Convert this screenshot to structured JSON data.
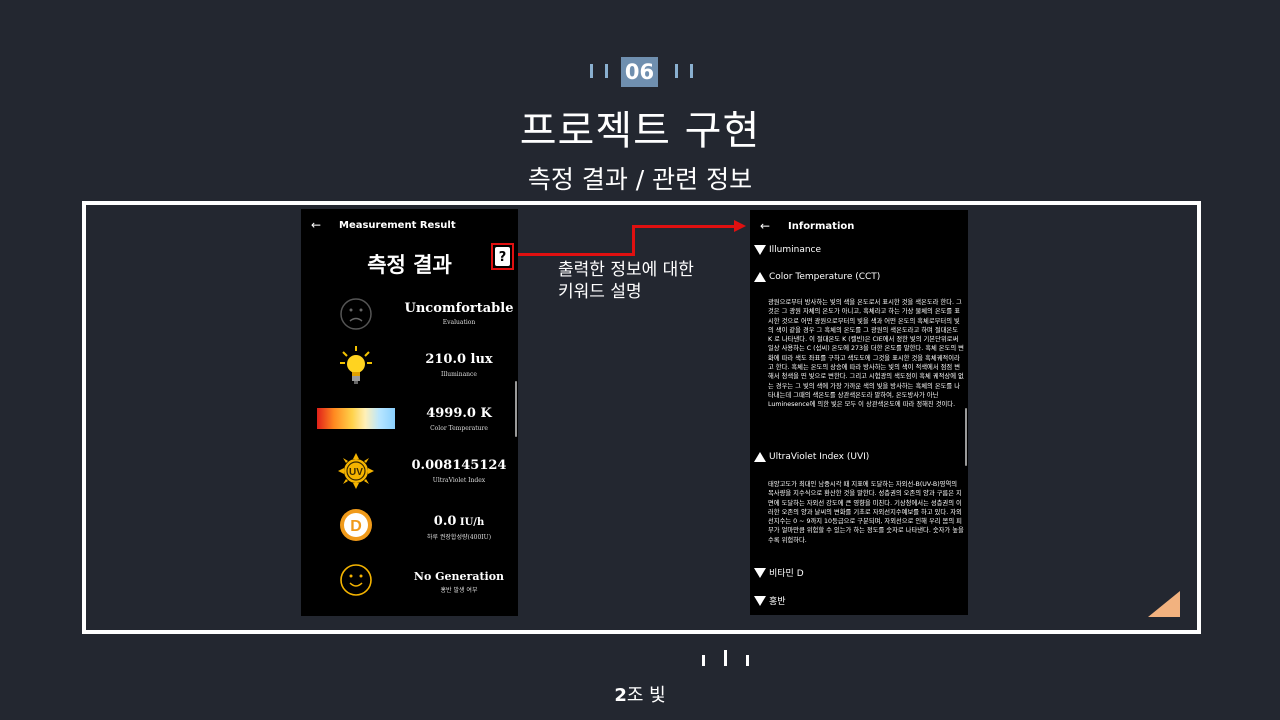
{
  "slide": {
    "section_number": "06",
    "title": "프로젝트 구현",
    "subtitle": "측정 결과 / 관련 정보",
    "team_number": "2",
    "team_suffix": "조 빛",
    "accent_color": "#6f8faf",
    "triangle_color": "#f2b27f"
  },
  "annotation": {
    "text": "출력한 정보에 대한\n키워드 설명",
    "line_color": "#e01010"
  },
  "left_screen": {
    "appbar_title": "Measurement Result",
    "back_icon": "arrow-left-icon",
    "heading": "측정 결과",
    "help_icon": "help-question-icon",
    "rows": [
      {
        "icon": "sad-face-icon",
        "value": "Uncomfortable",
        "label": "Evaluation"
      },
      {
        "icon": "lightbulb-icon",
        "value": "210.0 lux",
        "label": "Illuminance"
      },
      {
        "icon": "color-gradient-bar",
        "value": "4999.0 K",
        "label": "Color Temperature"
      },
      {
        "icon": "uv-sun-icon",
        "value": "0.008145124",
        "label": "UltraViolet Index"
      },
      {
        "icon": "vitamin-d-icon",
        "value": "0.0",
        "unit": "IU/h",
        "label": "하루 권장합성량(400IU)"
      },
      {
        "icon": "smile-face-icon",
        "value": "No Generation",
        "label": "홍반 발생 여부"
      }
    ]
  },
  "right_screen": {
    "appbar_title": "Information",
    "back_icon": "arrow-left-icon",
    "items": [
      {
        "title": "Illuminance",
        "expanded": false
      },
      {
        "title": "Color Temperature (CCT)",
        "expanded": true,
        "body": "광원으로부터 방사하는 빛의 색을 온도로서 표시한 것을 색온도라 한다. 그것은 그 광원 자체의 온도가 아니고, 흑체라고 하는 가상 물체의 온도를 표시한 것으로 어떤 광원으로부터의 빛을 색과 어떤 온도의 흑체로부터의 빛의 색이 같을 경우 그 흑체의 온도를 그 광원의 색온도라고 하며 절대온도 K 로 나타낸다. 이 절대온도 K (켈빈)은 CIE에서 정한 빛의 기본단위로써 일상 사용하는 C (섭씨) 온도에 273을 더한 온도를 말한다. 흑체 온도의 변화에 따라 색도 좌표를 구하고 색도도에 그것을 표시한 것을 흑체궤적이라고 한다. 흑체는 온도의 상승에 따라 방사하는 빛의 색이 적색에서 점점 변해서 청색을 띤 빛으로 변한다. 그리고 시험광의 색도점이 흑체 궤적상에 없는 경우는 그 빛의 색에 가장 가까운 색의 빛을 방사하는 흑체의 온도를 나타내는데 그때의 색온도를 상관색온도라 말하여, 온도방사가 아닌 Luminesence에 의한 빛은 모두 이 상관색온도에 따라 정해진 것이다."
      },
      {
        "title": "UltraViolet Index (UVI)",
        "expanded": true,
        "body": "태양고도가 최대인 남중시각 때 지표에 도달하는 자외선-B(UV-B)영역의 복사량을 지수식으로 환산한 것을 말한다. 성층권의 오존의 양과 구름은 지면에 도달하는 자외선 강도에 큰 영향을 미친다. 기상청에서는 성층권의 이러한 오존의 양과 날씨의 변화를 기초로 자외선지수예보를 하고 있다. 자외선지수는 0 ~ 9까지 10등급으로 구분되며, 자외선으로 인해 우리 몸의 피부가 얼마만큼 위험할 수 있는가 하는 정도를 숫자로 나타낸다. 숫자가 높을수록 위험하다."
      },
      {
        "title": "비타민 D",
        "expanded": false
      },
      {
        "title": "홍반",
        "expanded": false
      }
    ]
  }
}
